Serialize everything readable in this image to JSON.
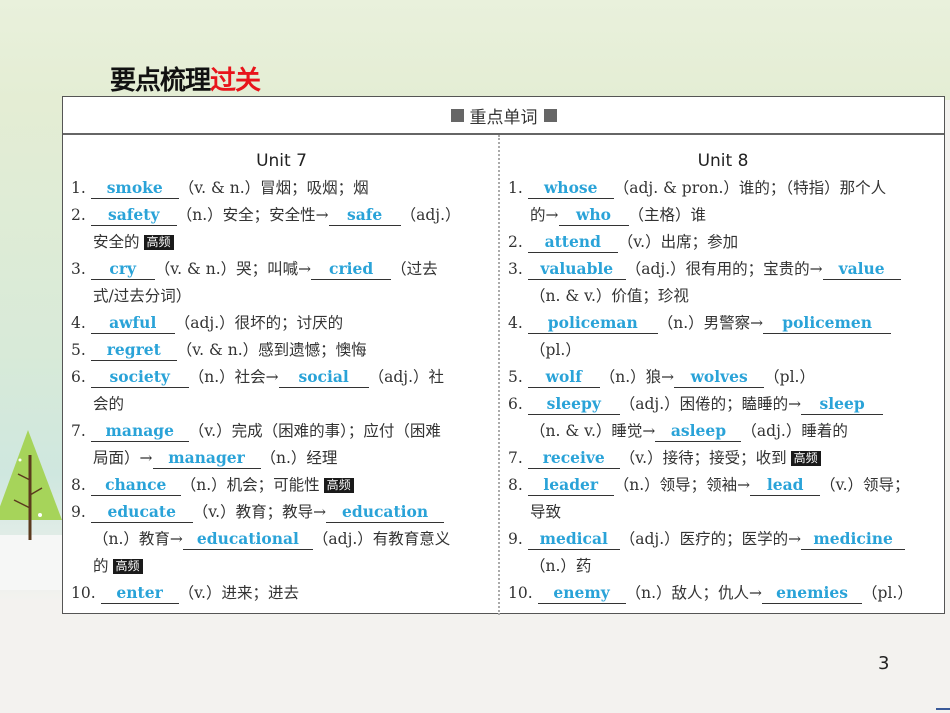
{
  "page": {
    "title_black": "要点梳理",
    "title_red": "过关",
    "page_number": "3",
    "colors": {
      "title_accent": "#e8141b",
      "answer": "#2aa3d8",
      "tag_bg": "#1a1a1a"
    }
  },
  "table": {
    "header": "重点单词",
    "tag_label": "高频",
    "arrow": "→",
    "unit7": {
      "title": "Unit 7",
      "items": [
        {
          "num": "1.",
          "w1": "smoke",
          "t1": "（v. & n.）冒烟；吸烟；烟"
        },
        {
          "num": "2.",
          "w1": "safety",
          "t1": "（n.）安全；安全性→",
          "w2": "safe",
          "t2": "（adj.）",
          "cont": "安全的"
        },
        {
          "num": "3.",
          "w1": "cry",
          "t1": "（v. & n.）哭；叫喊→",
          "w2": "cried",
          "t2": "（过去",
          "cont": "式/过去分词）"
        },
        {
          "num": "4.",
          "w1": "awful",
          "t1": "（adj.）很坏的；讨厌的"
        },
        {
          "num": "5.",
          "w1": "regret",
          "t1": "（v. & n.）感到遗憾；懊悔"
        },
        {
          "num": "6.",
          "w1": "society",
          "t1": "（n.）社会→",
          "w2": "social",
          "t2": "（adj.）社",
          "cont": "会的"
        },
        {
          "num": "7.",
          "w1": "manage",
          "t1": "（v.）完成（困难的事）；应付（困难",
          "cont": "局面）→",
          "w2": "manager",
          "t2": "（n.）经理"
        },
        {
          "num": "8.",
          "w1": "chance",
          "t1": "（n.）机会；可能性"
        },
        {
          "num": "9.",
          "w1": "educate",
          "t1": "（v.）教育；教导→",
          "w2": "education",
          "cont": "（n.）教育→",
          "w3": "educational",
          "t3": "（adj.）有教育意义",
          "cont2": "的"
        },
        {
          "num": "10.",
          "w1": "enter",
          "t1": "（v.）进来；进去"
        }
      ]
    },
    "unit8": {
      "title": "Unit 8",
      "items": [
        {
          "num": "1.",
          "w1": "whose",
          "t1": "（adj. & pron.）谁的；（特指）那个人",
          "cont": "的→",
          "w2": "who",
          "t2": "（主格）谁"
        },
        {
          "num": "2.",
          "w1": "attend",
          "t1": "（v.）出席；参加"
        },
        {
          "num": "3.",
          "w1": "valuable",
          "t1": "（adj.）很有用的；宝贵的→",
          "w2": "value",
          "cont": "（n. & v.）价值；珍视"
        },
        {
          "num": "4.",
          "w1": "policeman",
          "t1": "（n.）男警察→",
          "w2": "policemen",
          "cont": "（pl.）"
        },
        {
          "num": "5.",
          "w1": "wolf",
          "t1": "（n.）狼→",
          "w2": "wolves",
          "t2": "（pl.）"
        },
        {
          "num": "6.",
          "w1": "sleepy",
          "t1": "（adj.）困倦的；瞌睡的→",
          "w2": "sleep",
          "cont": "（n. & v.）睡觉→",
          "w3": "asleep",
          "t3": "（adj.）睡着的"
        },
        {
          "num": "7.",
          "w1": "receive",
          "t1": "（v.）接待；接受；收到"
        },
        {
          "num": "8.",
          "w1": "leader",
          "t1": "（n.）领导；领袖→",
          "w2": "lead",
          "t2": "（v.）领导；",
          "cont": "导致"
        },
        {
          "num": "9.",
          "w1": "medical",
          "t1": "（adj.）医疗的；医学的→",
          "w2": "medicine",
          "cont": "（n.）药"
        },
        {
          "num": "10.",
          "w1": "enemy",
          "t1": "（n.）敌人；仇人→",
          "w2": "enemies",
          "t2": "（pl.）"
        }
      ]
    }
  }
}
